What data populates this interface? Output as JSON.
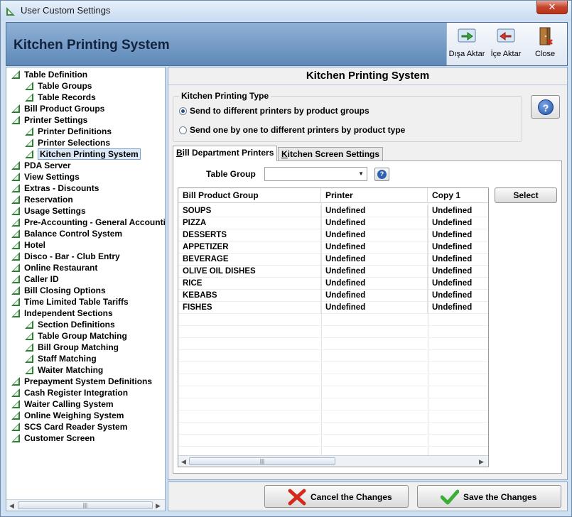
{
  "window": {
    "title": "User Custom Settings",
    "close_glyph": "✕"
  },
  "header": {
    "title": "Kitchen Printing System",
    "toolbar": [
      {
        "label": "Dışa Aktar",
        "icon": "export-icon"
      },
      {
        "label": "İçe Aktar",
        "icon": "import-icon"
      },
      {
        "label": "Close",
        "icon": "door-close-icon"
      }
    ]
  },
  "tree": [
    {
      "label": "Table Definition",
      "level": 0
    },
    {
      "label": "Table Groups",
      "level": 1
    },
    {
      "label": "Table Records",
      "level": 1
    },
    {
      "label": "Bill Product Groups",
      "level": 0
    },
    {
      "label": "Printer Settings",
      "level": 0
    },
    {
      "label": "Printer Definitions",
      "level": 1
    },
    {
      "label": "Printer Selections",
      "level": 1
    },
    {
      "label": "Kitchen Printing System",
      "level": 1,
      "selected": true
    },
    {
      "label": "PDA Server",
      "level": 0
    },
    {
      "label": "View Settings",
      "level": 0
    },
    {
      "label": "Extras - Discounts",
      "level": 0
    },
    {
      "label": "Reservation",
      "level": 0
    },
    {
      "label": "Usage Settings",
      "level": 0
    },
    {
      "label": "Pre-Accounting - General Accounting",
      "level": 0
    },
    {
      "label": "Balance Control System",
      "level": 0
    },
    {
      "label": "Hotel",
      "level": 0
    },
    {
      "label": "Disco - Bar - Club Entry",
      "level": 0
    },
    {
      "label": "Online Restaurant",
      "level": 0
    },
    {
      "label": "Caller ID",
      "level": 0
    },
    {
      "label": "Bill Closing Options",
      "level": 0
    },
    {
      "label": "Time Limited Table Tariffs",
      "level": 0
    },
    {
      "label": "Independent Sections",
      "level": 0
    },
    {
      "label": "Section Definitions",
      "level": 1
    },
    {
      "label": "Table Group Matching",
      "level": 1
    },
    {
      "label": "Bill Group Matching",
      "level": 1
    },
    {
      "label": "Staff Matching",
      "level": 1
    },
    {
      "label": "Waiter Matching",
      "level": 1
    },
    {
      "label": "Prepayment System Definitions",
      "level": 0
    },
    {
      "label": "Cash Register Integration",
      "level": 0
    },
    {
      "label": "Waiter Calling System",
      "level": 0
    },
    {
      "label": "Online Weighing System",
      "level": 0
    },
    {
      "label": "SCS Card Reader System",
      "level": 0
    },
    {
      "label": "Customer Screen",
      "level": 0
    }
  ],
  "panel": {
    "title": "Kitchen Printing System",
    "printing_type": {
      "label": "Kitchen Printing Type",
      "options": [
        {
          "label": "Send to different printers by product groups",
          "selected": true
        },
        {
          "label": "Send one by one to different printers by product type",
          "selected": false
        }
      ]
    },
    "tabs": [
      {
        "label_u": "B",
        "label_rest": "ill Department Printers",
        "active": true
      },
      {
        "label_u": "K",
        "label_rest": "itchen Screen Settings",
        "active": false
      }
    ],
    "table_group": {
      "label": "Table Group",
      "value": ""
    },
    "select_label": "Select",
    "grid": {
      "columns": [
        "Bill Product Group",
        "Printer",
        "Copy 1"
      ],
      "rows": [
        [
          "SOUPS",
          "Undefined",
          "Undefined"
        ],
        [
          "PIZZA",
          "Undefined",
          "Undefined"
        ],
        [
          "DESSERTS",
          "Undefined",
          "Undefined"
        ],
        [
          "APPETIZER",
          "Undefined",
          "Undefined"
        ],
        [
          "BEVERAGE",
          "Undefined",
          "Undefined"
        ],
        [
          "OLIVE OIL DISHES",
          "Undefined",
          "Undefined"
        ],
        [
          "RICE",
          "Undefined",
          "Undefined"
        ],
        [
          "KEBABS",
          "Undefined",
          "Undefined"
        ],
        [
          "FISHES",
          "Undefined",
          "Undefined"
        ]
      ]
    }
  },
  "buttons": {
    "cancel": "Cancel the Changes",
    "save": "Save the Changes"
  },
  "colors": {
    "tree_icon": "#2e7d32",
    "header_bg": "#6f96c4",
    "accent": "#1e4c88"
  }
}
